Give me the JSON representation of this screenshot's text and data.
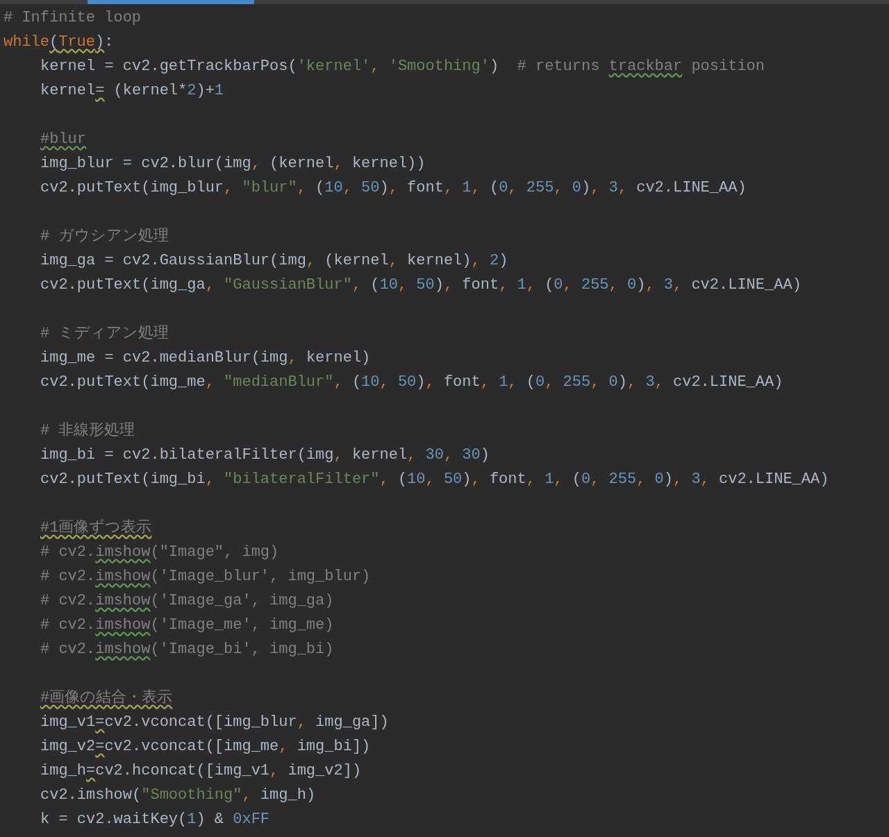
{
  "editor": {
    "lines": [
      {
        "kind": "code",
        "indent": false,
        "tokens": [
          {
            "kind": "comment",
            "text": "# Infinite loop"
          }
        ]
      },
      {
        "kind": "code",
        "indent": false,
        "tokens": [
          {
            "kind": "keyword",
            "text": "while"
          },
          {
            "kind": "plain",
            "text": "(",
            "warning": true
          },
          {
            "kind": "keyword",
            "text": "True",
            "warning": true
          },
          {
            "kind": "plain",
            "text": ")",
            "warning": true
          },
          {
            "kind": "plain",
            "text": ":"
          }
        ]
      },
      {
        "kind": "code",
        "indent": true,
        "tokens": [
          {
            "kind": "plain",
            "text": "kernel = cv2.getTrackbarPos("
          },
          {
            "kind": "string",
            "text": "'kernel'"
          },
          {
            "kind": "keyword",
            "text": ", "
          },
          {
            "kind": "string",
            "text": "'Smoothing'"
          },
          {
            "kind": "plain",
            "text": ")  "
          },
          {
            "kind": "comment",
            "text": "# returns "
          },
          {
            "kind": "comment",
            "text": "trackbar",
            "typo": true
          },
          {
            "kind": "comment",
            "text": " position"
          }
        ]
      },
      {
        "kind": "code",
        "indent": true,
        "tokens": [
          {
            "kind": "plain",
            "text": "kernel"
          },
          {
            "kind": "plain",
            "text": "=",
            "warning": true
          },
          {
            "kind": "plain",
            "text": " (kernel*"
          },
          {
            "kind": "number",
            "text": "2"
          },
          {
            "kind": "plain",
            "text": ")+"
          },
          {
            "kind": "number",
            "text": "1"
          }
        ]
      },
      {
        "kind": "blank"
      },
      {
        "kind": "code",
        "indent": true,
        "tokens": [
          {
            "kind": "comment",
            "text": "#blur",
            "typo": true
          }
        ]
      },
      {
        "kind": "code",
        "indent": true,
        "tokens": [
          {
            "kind": "plain",
            "text": "img_blur = cv2.blur(img"
          },
          {
            "kind": "keyword",
            "text": ", "
          },
          {
            "kind": "plain",
            "text": "(kernel"
          },
          {
            "kind": "keyword",
            "text": ", "
          },
          {
            "kind": "plain",
            "text": "kernel))"
          }
        ]
      },
      {
        "kind": "code",
        "indent": true,
        "tokens": [
          {
            "kind": "plain",
            "text": "cv2.putText(img_blur"
          },
          {
            "kind": "keyword",
            "text": ", "
          },
          {
            "kind": "string",
            "text": "\"blur\""
          },
          {
            "kind": "keyword",
            "text": ", "
          },
          {
            "kind": "plain",
            "text": "("
          },
          {
            "kind": "number",
            "text": "10"
          },
          {
            "kind": "keyword",
            "text": ", "
          },
          {
            "kind": "number",
            "text": "50"
          },
          {
            "kind": "plain",
            "text": ")"
          },
          {
            "kind": "keyword",
            "text": ", "
          },
          {
            "kind": "plain",
            "text": "font"
          },
          {
            "kind": "keyword",
            "text": ", "
          },
          {
            "kind": "number",
            "text": "1"
          },
          {
            "kind": "keyword",
            "text": ", "
          },
          {
            "kind": "plain",
            "text": "("
          },
          {
            "kind": "number",
            "text": "0"
          },
          {
            "kind": "keyword",
            "text": ", "
          },
          {
            "kind": "number",
            "text": "255"
          },
          {
            "kind": "keyword",
            "text": ", "
          },
          {
            "kind": "number",
            "text": "0"
          },
          {
            "kind": "plain",
            "text": ")"
          },
          {
            "kind": "keyword",
            "text": ", "
          },
          {
            "kind": "number",
            "text": "3"
          },
          {
            "kind": "keyword",
            "text": ", "
          },
          {
            "kind": "plain",
            "text": "cv2.LINE_AA)"
          }
        ]
      },
      {
        "kind": "blank"
      },
      {
        "kind": "code",
        "indent": true,
        "tokens": [
          {
            "kind": "comment",
            "text": "# ガウシアン処理"
          }
        ]
      },
      {
        "kind": "code",
        "indent": true,
        "tokens": [
          {
            "kind": "plain",
            "text": "img_ga = cv2.GaussianBlur(img"
          },
          {
            "kind": "keyword",
            "text": ", "
          },
          {
            "kind": "plain",
            "text": "(kernel"
          },
          {
            "kind": "keyword",
            "text": ", "
          },
          {
            "kind": "plain",
            "text": "kernel)"
          },
          {
            "kind": "keyword",
            "text": ", "
          },
          {
            "kind": "number",
            "text": "2"
          },
          {
            "kind": "plain",
            "text": ")"
          }
        ]
      },
      {
        "kind": "code",
        "indent": true,
        "tokens": [
          {
            "kind": "plain",
            "text": "cv2.putText(img_ga"
          },
          {
            "kind": "keyword",
            "text": ", "
          },
          {
            "kind": "string",
            "text": "\"GaussianBlur\""
          },
          {
            "kind": "keyword",
            "text": ", "
          },
          {
            "kind": "plain",
            "text": "("
          },
          {
            "kind": "number",
            "text": "10"
          },
          {
            "kind": "keyword",
            "text": ", "
          },
          {
            "kind": "number",
            "text": "50"
          },
          {
            "kind": "plain",
            "text": ")"
          },
          {
            "kind": "keyword",
            "text": ", "
          },
          {
            "kind": "plain",
            "text": "font"
          },
          {
            "kind": "keyword",
            "text": ", "
          },
          {
            "kind": "number",
            "text": "1"
          },
          {
            "kind": "keyword",
            "text": ", "
          },
          {
            "kind": "plain",
            "text": "("
          },
          {
            "kind": "number",
            "text": "0"
          },
          {
            "kind": "keyword",
            "text": ", "
          },
          {
            "kind": "number",
            "text": "255"
          },
          {
            "kind": "keyword",
            "text": ", "
          },
          {
            "kind": "number",
            "text": "0"
          },
          {
            "kind": "plain",
            "text": ")"
          },
          {
            "kind": "keyword",
            "text": ", "
          },
          {
            "kind": "number",
            "text": "3"
          },
          {
            "kind": "keyword",
            "text": ", "
          },
          {
            "kind": "plain",
            "text": "cv2.LINE_AA)"
          }
        ]
      },
      {
        "kind": "blank"
      },
      {
        "kind": "code",
        "indent": true,
        "tokens": [
          {
            "kind": "comment",
            "text": "# ミディアン処理"
          }
        ]
      },
      {
        "kind": "code",
        "indent": true,
        "tokens": [
          {
            "kind": "plain",
            "text": "img_me = cv2.medianBlur(img"
          },
          {
            "kind": "keyword",
            "text": ", "
          },
          {
            "kind": "plain",
            "text": "kernel)"
          }
        ]
      },
      {
        "kind": "code",
        "indent": true,
        "tokens": [
          {
            "kind": "plain",
            "text": "cv2.putText(img_me"
          },
          {
            "kind": "keyword",
            "text": ", "
          },
          {
            "kind": "string",
            "text": "\"medianBlur\""
          },
          {
            "kind": "keyword",
            "text": ", "
          },
          {
            "kind": "plain",
            "text": "("
          },
          {
            "kind": "number",
            "text": "10"
          },
          {
            "kind": "keyword",
            "text": ", "
          },
          {
            "kind": "number",
            "text": "50"
          },
          {
            "kind": "plain",
            "text": ")"
          },
          {
            "kind": "keyword",
            "text": ", "
          },
          {
            "kind": "plain",
            "text": "font"
          },
          {
            "kind": "keyword",
            "text": ", "
          },
          {
            "kind": "number",
            "text": "1"
          },
          {
            "kind": "keyword",
            "text": ", "
          },
          {
            "kind": "plain",
            "text": "("
          },
          {
            "kind": "number",
            "text": "0"
          },
          {
            "kind": "keyword",
            "text": ", "
          },
          {
            "kind": "number",
            "text": "255"
          },
          {
            "kind": "keyword",
            "text": ", "
          },
          {
            "kind": "number",
            "text": "0"
          },
          {
            "kind": "plain",
            "text": ")"
          },
          {
            "kind": "keyword",
            "text": ", "
          },
          {
            "kind": "number",
            "text": "3"
          },
          {
            "kind": "keyword",
            "text": ", "
          },
          {
            "kind": "plain",
            "text": "cv2.LINE_AA)"
          }
        ]
      },
      {
        "kind": "blank"
      },
      {
        "kind": "code",
        "indent": true,
        "tokens": [
          {
            "kind": "comment",
            "text": "# 非線形処理"
          }
        ]
      },
      {
        "kind": "code",
        "indent": true,
        "tokens": [
          {
            "kind": "plain",
            "text": "img_bi = cv2.bilateralFilter(img"
          },
          {
            "kind": "keyword",
            "text": ", "
          },
          {
            "kind": "plain",
            "text": "kernel"
          },
          {
            "kind": "keyword",
            "text": ", "
          },
          {
            "kind": "number",
            "text": "30"
          },
          {
            "kind": "keyword",
            "text": ", "
          },
          {
            "kind": "number",
            "text": "30"
          },
          {
            "kind": "plain",
            "text": ")"
          }
        ]
      },
      {
        "kind": "code",
        "indent": true,
        "tokens": [
          {
            "kind": "plain",
            "text": "cv2.putText(img_bi"
          },
          {
            "kind": "keyword",
            "text": ", "
          },
          {
            "kind": "string",
            "text": "\"bilateralFilter\""
          },
          {
            "kind": "keyword",
            "text": ", "
          },
          {
            "kind": "plain",
            "text": "("
          },
          {
            "kind": "number",
            "text": "10"
          },
          {
            "kind": "keyword",
            "text": ", "
          },
          {
            "kind": "number",
            "text": "50"
          },
          {
            "kind": "plain",
            "text": ")"
          },
          {
            "kind": "keyword",
            "text": ", "
          },
          {
            "kind": "plain",
            "text": "font"
          },
          {
            "kind": "keyword",
            "text": ", "
          },
          {
            "kind": "number",
            "text": "1"
          },
          {
            "kind": "keyword",
            "text": ", "
          },
          {
            "kind": "plain",
            "text": "("
          },
          {
            "kind": "number",
            "text": "0"
          },
          {
            "kind": "keyword",
            "text": ", "
          },
          {
            "kind": "number",
            "text": "255"
          },
          {
            "kind": "keyword",
            "text": ", "
          },
          {
            "kind": "number",
            "text": "0"
          },
          {
            "kind": "plain",
            "text": ")"
          },
          {
            "kind": "keyword",
            "text": ", "
          },
          {
            "kind": "number",
            "text": "3"
          },
          {
            "kind": "keyword",
            "text": ", "
          },
          {
            "kind": "plain",
            "text": "cv2.LINE_AA)"
          }
        ]
      },
      {
        "kind": "blank"
      },
      {
        "kind": "code",
        "indent": true,
        "tokens": [
          {
            "kind": "comment",
            "text": "#1画像ずつ表示",
            "warning": true
          }
        ]
      },
      {
        "kind": "code",
        "indent": true,
        "tokens": [
          {
            "kind": "comment",
            "text": "# cv2."
          },
          {
            "kind": "comment",
            "text": "imshow",
            "typo": true
          },
          {
            "kind": "comment",
            "text": "(\"Image\", img)"
          }
        ]
      },
      {
        "kind": "code",
        "indent": true,
        "tokens": [
          {
            "kind": "comment",
            "text": "# cv2."
          },
          {
            "kind": "comment",
            "text": "imshow",
            "typo": true
          },
          {
            "kind": "comment",
            "text": "('Image_blur', img_blur)"
          }
        ]
      },
      {
        "kind": "code",
        "indent": true,
        "tokens": [
          {
            "kind": "comment",
            "text": "# cv2."
          },
          {
            "kind": "comment",
            "text": "imshow",
            "typo": true
          },
          {
            "kind": "comment",
            "text": "('Image_ga', img_ga)"
          }
        ]
      },
      {
        "kind": "code",
        "indent": true,
        "tokens": [
          {
            "kind": "comment",
            "text": "# cv2."
          },
          {
            "kind": "comment",
            "text": "imshow",
            "typo": true
          },
          {
            "kind": "comment",
            "text": "('Image_me', img_me)"
          }
        ]
      },
      {
        "kind": "code",
        "indent": true,
        "tokens": [
          {
            "kind": "comment",
            "text": "# cv2."
          },
          {
            "kind": "comment",
            "text": "imshow",
            "typo": true
          },
          {
            "kind": "comment",
            "text": "('Image_bi', img_bi)"
          }
        ]
      },
      {
        "kind": "blank"
      },
      {
        "kind": "code",
        "indent": true,
        "tokens": [
          {
            "kind": "comment",
            "text": "#画像の結合・表示",
            "warning": true
          }
        ]
      },
      {
        "kind": "code",
        "indent": true,
        "tokens": [
          {
            "kind": "plain",
            "text": "img_v1"
          },
          {
            "kind": "plain",
            "text": "=",
            "warning": true
          },
          {
            "kind": "plain",
            "text": "cv2.vconcat([img_blur"
          },
          {
            "kind": "keyword",
            "text": ", "
          },
          {
            "kind": "plain",
            "text": "img_ga])"
          }
        ]
      },
      {
        "kind": "code",
        "indent": true,
        "tokens": [
          {
            "kind": "plain",
            "text": "img_v2"
          },
          {
            "kind": "plain",
            "text": "=",
            "warning": true
          },
          {
            "kind": "plain",
            "text": "cv2.vconcat([img_me"
          },
          {
            "kind": "keyword",
            "text": ", "
          },
          {
            "kind": "plain",
            "text": "img_bi])"
          }
        ]
      },
      {
        "kind": "code",
        "indent": true,
        "tokens": [
          {
            "kind": "plain",
            "text": "img_h"
          },
          {
            "kind": "plain",
            "text": "=",
            "warning": true
          },
          {
            "kind": "plain",
            "text": "cv2.hconcat([img_v1"
          },
          {
            "kind": "keyword",
            "text": ", "
          },
          {
            "kind": "plain",
            "text": "img_v2])"
          }
        ]
      },
      {
        "kind": "code",
        "indent": true,
        "tokens": [
          {
            "kind": "plain",
            "text": "cv2.imshow("
          },
          {
            "kind": "string",
            "text": "\"Smoothing\""
          },
          {
            "kind": "keyword",
            "text": ", "
          },
          {
            "kind": "plain",
            "text": "img_h)"
          }
        ]
      },
      {
        "kind": "code",
        "indent": true,
        "tokens": [
          {
            "kind": "plain",
            "text": "k = cv2.waitKey("
          },
          {
            "kind": "number",
            "text": "1"
          },
          {
            "kind": "plain",
            "text": ") & "
          },
          {
            "kind": "number",
            "text": "0xFF"
          }
        ]
      }
    ]
  }
}
